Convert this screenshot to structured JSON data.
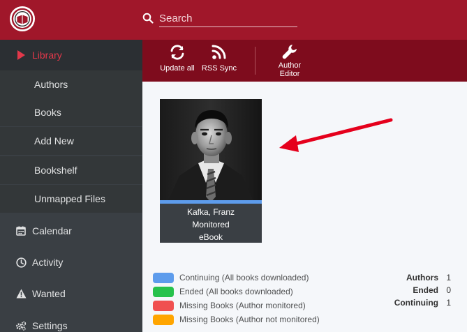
{
  "header": {
    "search_placeholder": "Search"
  },
  "sidebar": {
    "library": "Library",
    "sub_items": [
      "Authors",
      "Books",
      "Add New",
      "Bookshelf",
      "Unmapped Files"
    ],
    "calendar": "Calendar",
    "activity": "Activity",
    "wanted": "Wanted",
    "settings": "Settings"
  },
  "toolbar": {
    "update_all": "Update all",
    "rss_sync": "RSS Sync",
    "author_editor_line1": "Author",
    "author_editor_line2": "Editor"
  },
  "author_card": {
    "name": "Kafka, Franz",
    "status": "Monitored",
    "format": "eBook"
  },
  "legend": [
    {
      "label": "Continuing (All books downloaded)",
      "color": "#5d9cec"
    },
    {
      "label": "Ended (All books downloaded)",
      "color": "#27c24c"
    },
    {
      "label": "Missing Books (Author monitored)",
      "color": "#f05050"
    },
    {
      "label": "Missing Books (Author not monitored)",
      "color": "#ffa500"
    }
  ],
  "stats": [
    {
      "label": "Authors",
      "value": "1"
    },
    {
      "label": "Ended",
      "value": "0"
    },
    {
      "label": "Continuing",
      "value": "1"
    }
  ],
  "colors": {
    "header": "#a0172a",
    "toolbar": "#7e0c1d",
    "sidebar": "#3a3f44",
    "active": "#e2384a",
    "annotation": "#e5001c"
  }
}
